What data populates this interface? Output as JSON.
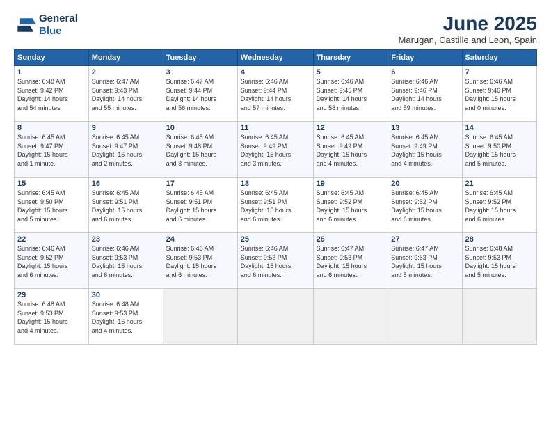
{
  "logo": {
    "line1": "General",
    "line2": "Blue"
  },
  "title": "June 2025",
  "location": "Marugan, Castille and Leon, Spain",
  "weekdays": [
    "Sunday",
    "Monday",
    "Tuesday",
    "Wednesday",
    "Thursday",
    "Friday",
    "Saturday"
  ],
  "weeks": [
    [
      {
        "day": "1",
        "info": "Sunrise: 6:48 AM\nSunset: 9:42 PM\nDaylight: 14 hours\nand 54 minutes."
      },
      {
        "day": "2",
        "info": "Sunrise: 6:47 AM\nSunset: 9:43 PM\nDaylight: 14 hours\nand 55 minutes."
      },
      {
        "day": "3",
        "info": "Sunrise: 6:47 AM\nSunset: 9:44 PM\nDaylight: 14 hours\nand 56 minutes."
      },
      {
        "day": "4",
        "info": "Sunrise: 6:46 AM\nSunset: 9:44 PM\nDaylight: 14 hours\nand 57 minutes."
      },
      {
        "day": "5",
        "info": "Sunrise: 6:46 AM\nSunset: 9:45 PM\nDaylight: 14 hours\nand 58 minutes."
      },
      {
        "day": "6",
        "info": "Sunrise: 6:46 AM\nSunset: 9:46 PM\nDaylight: 14 hours\nand 59 minutes."
      },
      {
        "day": "7",
        "info": "Sunrise: 6:46 AM\nSunset: 9:46 PM\nDaylight: 15 hours\nand 0 minutes."
      }
    ],
    [
      {
        "day": "8",
        "info": "Sunrise: 6:45 AM\nSunset: 9:47 PM\nDaylight: 15 hours\nand 1 minute."
      },
      {
        "day": "9",
        "info": "Sunrise: 6:45 AM\nSunset: 9:47 PM\nDaylight: 15 hours\nand 2 minutes."
      },
      {
        "day": "10",
        "info": "Sunrise: 6:45 AM\nSunset: 9:48 PM\nDaylight: 15 hours\nand 3 minutes."
      },
      {
        "day": "11",
        "info": "Sunrise: 6:45 AM\nSunset: 9:49 PM\nDaylight: 15 hours\nand 3 minutes."
      },
      {
        "day": "12",
        "info": "Sunrise: 6:45 AM\nSunset: 9:49 PM\nDaylight: 15 hours\nand 4 minutes."
      },
      {
        "day": "13",
        "info": "Sunrise: 6:45 AM\nSunset: 9:49 PM\nDaylight: 15 hours\nand 4 minutes."
      },
      {
        "day": "14",
        "info": "Sunrise: 6:45 AM\nSunset: 9:50 PM\nDaylight: 15 hours\nand 5 minutes."
      }
    ],
    [
      {
        "day": "15",
        "info": "Sunrise: 6:45 AM\nSunset: 9:50 PM\nDaylight: 15 hours\nand 5 minutes."
      },
      {
        "day": "16",
        "info": "Sunrise: 6:45 AM\nSunset: 9:51 PM\nDaylight: 15 hours\nand 6 minutes."
      },
      {
        "day": "17",
        "info": "Sunrise: 6:45 AM\nSunset: 9:51 PM\nDaylight: 15 hours\nand 6 minutes."
      },
      {
        "day": "18",
        "info": "Sunrise: 6:45 AM\nSunset: 9:51 PM\nDaylight: 15 hours\nand 6 minutes."
      },
      {
        "day": "19",
        "info": "Sunrise: 6:45 AM\nSunset: 9:52 PM\nDaylight: 15 hours\nand 6 minutes."
      },
      {
        "day": "20",
        "info": "Sunrise: 6:45 AM\nSunset: 9:52 PM\nDaylight: 15 hours\nand 6 minutes."
      },
      {
        "day": "21",
        "info": "Sunrise: 6:45 AM\nSunset: 9:52 PM\nDaylight: 15 hours\nand 6 minutes."
      }
    ],
    [
      {
        "day": "22",
        "info": "Sunrise: 6:46 AM\nSunset: 9:52 PM\nDaylight: 15 hours\nand 6 minutes."
      },
      {
        "day": "23",
        "info": "Sunrise: 6:46 AM\nSunset: 9:53 PM\nDaylight: 15 hours\nand 6 minutes."
      },
      {
        "day": "24",
        "info": "Sunrise: 6:46 AM\nSunset: 9:53 PM\nDaylight: 15 hours\nand 6 minutes."
      },
      {
        "day": "25",
        "info": "Sunrise: 6:46 AM\nSunset: 9:53 PM\nDaylight: 15 hours\nand 6 minutes."
      },
      {
        "day": "26",
        "info": "Sunrise: 6:47 AM\nSunset: 9:53 PM\nDaylight: 15 hours\nand 6 minutes."
      },
      {
        "day": "27",
        "info": "Sunrise: 6:47 AM\nSunset: 9:53 PM\nDaylight: 15 hours\nand 5 minutes."
      },
      {
        "day": "28",
        "info": "Sunrise: 6:48 AM\nSunset: 9:53 PM\nDaylight: 15 hours\nand 5 minutes."
      }
    ],
    [
      {
        "day": "29",
        "info": "Sunrise: 6:48 AM\nSunset: 9:53 PM\nDaylight: 15 hours\nand 4 minutes."
      },
      {
        "day": "30",
        "info": "Sunrise: 6:48 AM\nSunset: 9:53 PM\nDaylight: 15 hours\nand 4 minutes."
      },
      {
        "day": "",
        "info": ""
      },
      {
        "day": "",
        "info": ""
      },
      {
        "day": "",
        "info": ""
      },
      {
        "day": "",
        "info": ""
      },
      {
        "day": "",
        "info": ""
      }
    ]
  ]
}
